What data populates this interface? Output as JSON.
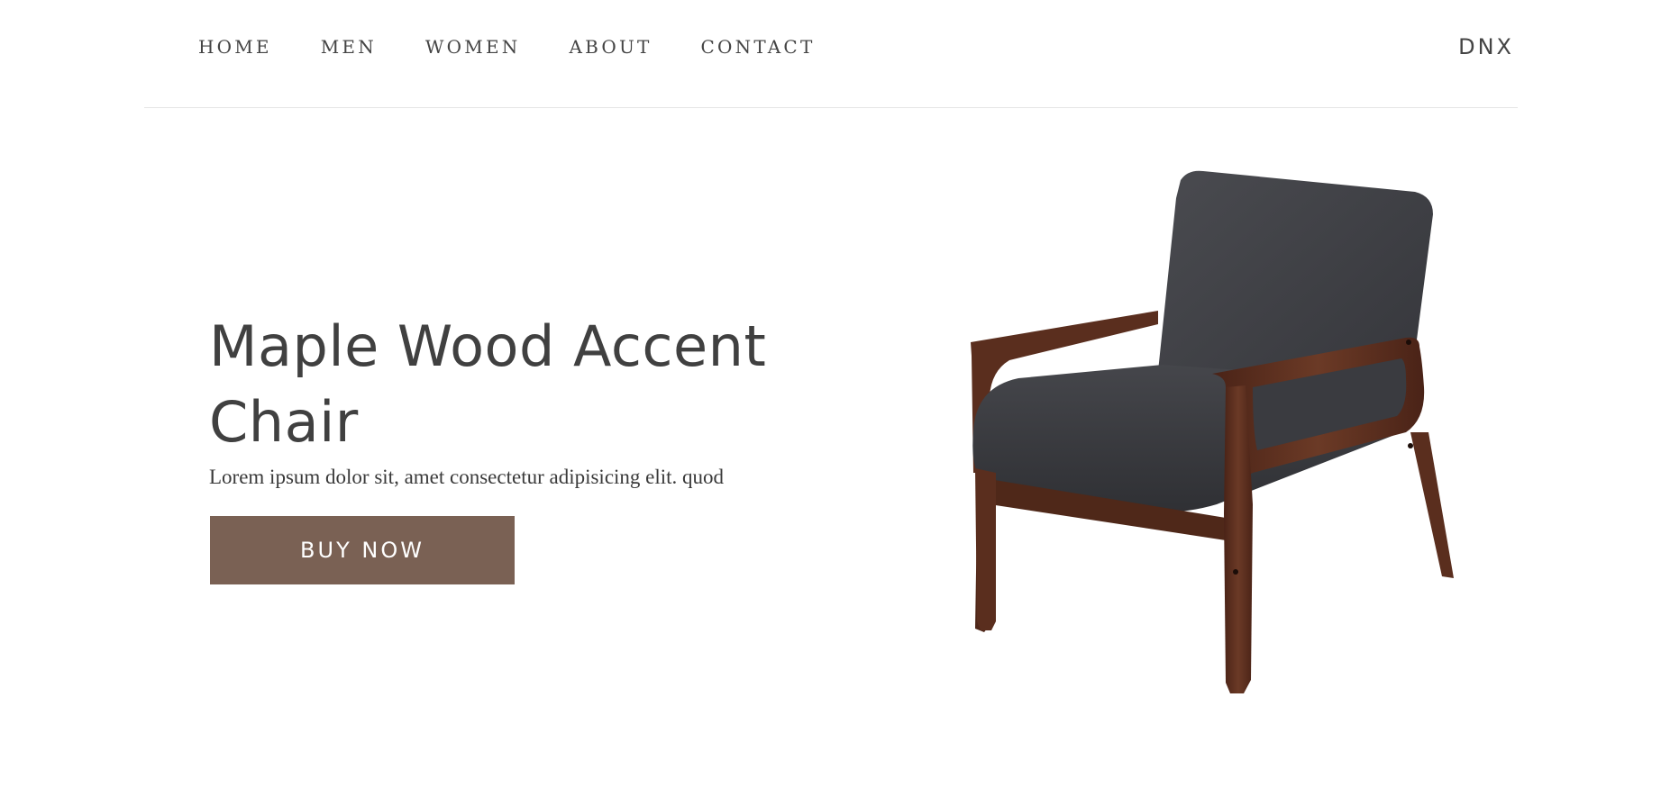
{
  "nav": {
    "links": [
      "HOME",
      "MEN",
      "WOMEN",
      "ABOUT",
      "CONTACT"
    ],
    "brand": "DNX"
  },
  "hero": {
    "title": "Maple Wood Accent Chair",
    "description": "Lorem ipsum dolor sit, amet consectetur adipisicing elit. quod",
    "cta_label": "BUY NOW",
    "image_name": "chair-image"
  },
  "colors": {
    "button": "#7a6154",
    "text": "#404040",
    "divider": "#e6e6e6",
    "upholstery": "#3d3e42",
    "wood": "#5a2e1e"
  }
}
